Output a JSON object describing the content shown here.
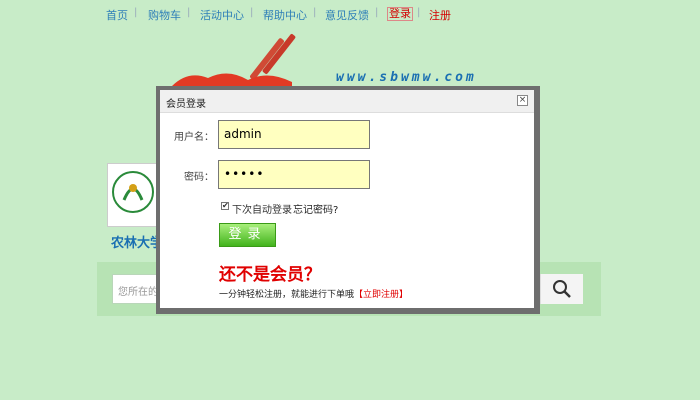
{
  "nav": {
    "items": [
      "首页",
      "购物车",
      "活动中心",
      "帮助中心",
      "意见反馈"
    ],
    "login": "登录",
    "register": "注册"
  },
  "site": {
    "domain": "www.sbwmw.com",
    "school_name": "农林大学"
  },
  "search": {
    "placeholder": "您所在的"
  },
  "modal": {
    "title": "会员登录",
    "close": "×",
    "username_label": "用户名：",
    "username_value": "admin",
    "password_label": "密码：",
    "password_value": "•••••",
    "remember_label": "下次自动登录",
    "remember_checked": true,
    "forgot_label": "忘记密码?",
    "login_button": "登录",
    "not_member": "还不是会员？",
    "tip": "一分钟轻松注册，就能进行下单哦",
    "register_now": "【立即注册】"
  },
  "colors": {
    "background": "#c8ecc8",
    "link": "#2e7fb8",
    "accent_red": "#e00000",
    "button_green": "#43b31d",
    "field_yellow": "#ffffc0"
  }
}
